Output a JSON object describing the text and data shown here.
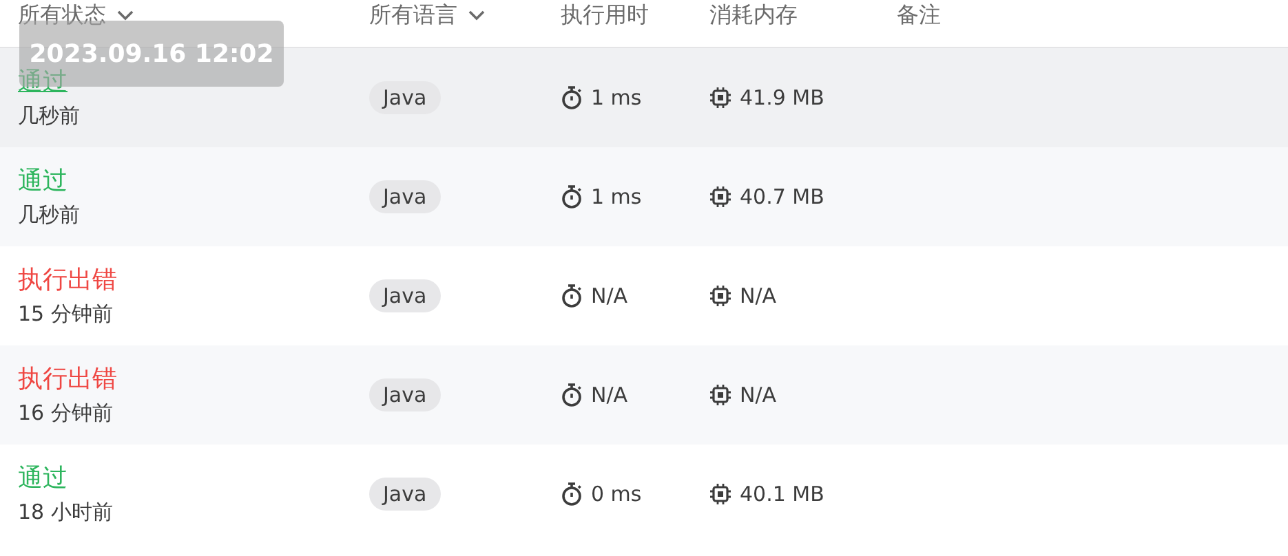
{
  "header": {
    "columns": [
      {
        "label": "所有状态",
        "dropdown": true
      },
      {
        "label": "所有语言",
        "dropdown": true
      },
      {
        "label": "执行用时",
        "dropdown": false
      },
      {
        "label": "消耗内存",
        "dropdown": false
      },
      {
        "label": "备注",
        "dropdown": false
      }
    ]
  },
  "tooltip": {
    "text": "2023.09.16 12:02"
  },
  "rows": [
    {
      "status": "通过",
      "kind": "accepted",
      "time_ago": "几秒前",
      "language": "Java",
      "runtime": "1 ms",
      "memory": "41.9 MB",
      "hovered": true
    },
    {
      "status": "通过",
      "kind": "accepted",
      "time_ago": "几秒前",
      "language": "Java",
      "runtime": "1 ms",
      "memory": "40.7 MB",
      "hovered": false
    },
    {
      "status": "执行出错",
      "kind": "error",
      "time_ago": "15 分钟前",
      "language": "Java",
      "runtime": "N/A",
      "memory": "N/A",
      "hovered": false
    },
    {
      "status": "执行出错",
      "kind": "error",
      "time_ago": "16 分钟前",
      "language": "Java",
      "runtime": "N/A",
      "memory": "N/A",
      "hovered": false
    },
    {
      "status": "通过",
      "kind": "accepted",
      "time_ago": "18 小时前",
      "language": "Java",
      "runtime": "0 ms",
      "memory": "40.1 MB",
      "hovered": false
    }
  ]
}
